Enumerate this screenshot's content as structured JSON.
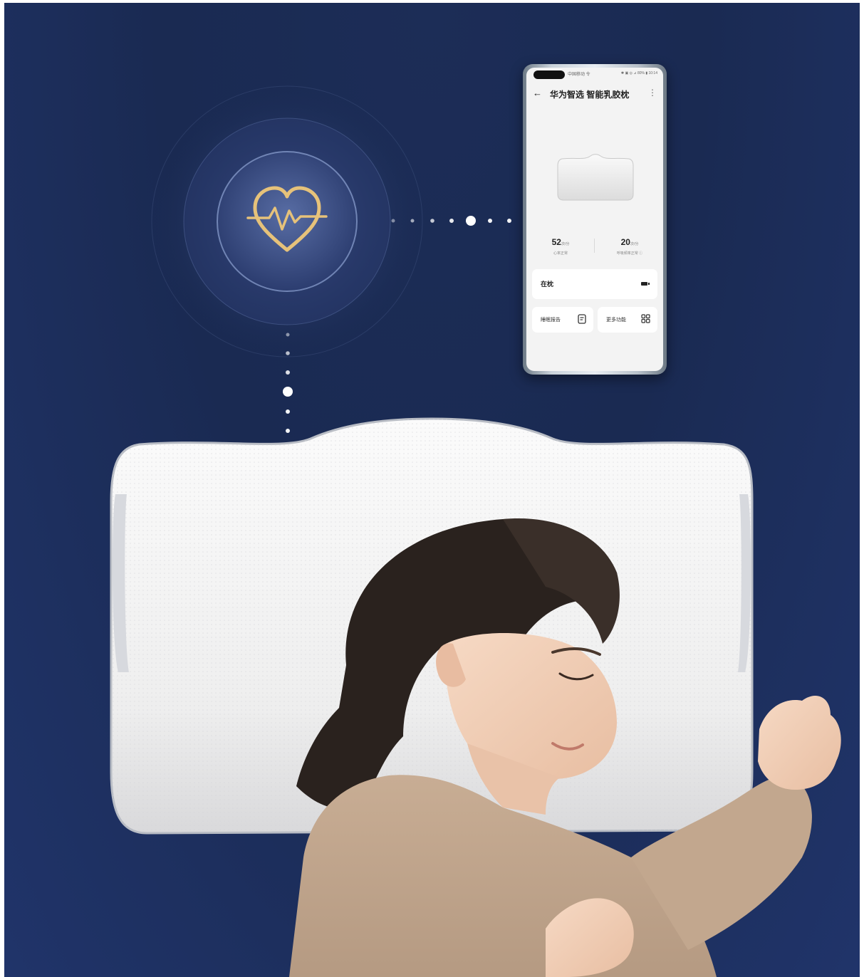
{
  "phone_app": {
    "status_left": "中国移动 令",
    "status_right": "✱ ▣ ◎ ⊿ 80% ▮ 10:14",
    "title": "华为智选 智能乳胶枕",
    "stats": [
      {
        "value": "52",
        "unit": "次/分",
        "label": "心率正常"
      },
      {
        "value": "20",
        "unit": "次/分",
        "label": "呼吸频率正常 ⓘ"
      }
    ],
    "device_status": "在枕",
    "buttons": [
      {
        "label": "睡眠报告",
        "icon": "report-icon"
      },
      {
        "label": "更多功能",
        "icon": "grid-icon"
      }
    ]
  },
  "heart_icon": "heart-pulse-icon",
  "colors": {
    "background": "#1c2d57",
    "heart_gold": "#e6c27a",
    "ring": "#5a6fa0"
  }
}
